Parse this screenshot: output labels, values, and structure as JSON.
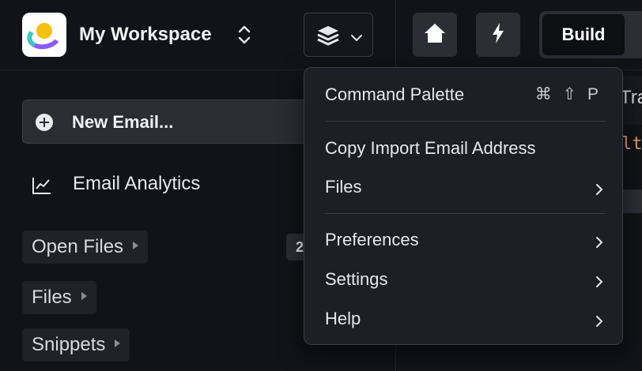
{
  "workspace": {
    "name": "My Workspace"
  },
  "toolbar": {
    "build_label": "Build"
  },
  "sidebar": {
    "new_email": "New Email...",
    "analytics": "Email Analytics",
    "sections": [
      {
        "label": "Open Files",
        "count": "2"
      },
      {
        "label": "Files"
      },
      {
        "label": "Snippets"
      }
    ]
  },
  "editor_peek": {
    "tab_text": "Tra",
    "code_text": "lt"
  },
  "menu": {
    "command_palette": {
      "label": "Command Palette",
      "shortcut": "⌘ ⇧ P"
    },
    "copy_import": "Copy Import Email Address",
    "files": "Files",
    "preferences": "Preferences",
    "settings": "Settings",
    "help": "Help"
  },
  "colors": {
    "background": "#111318",
    "menu_background": "#1c1f25",
    "logo_yellow": "#f4c20d",
    "logo_purple": "#8b5cf6",
    "code_accent": "#e59d6b"
  }
}
